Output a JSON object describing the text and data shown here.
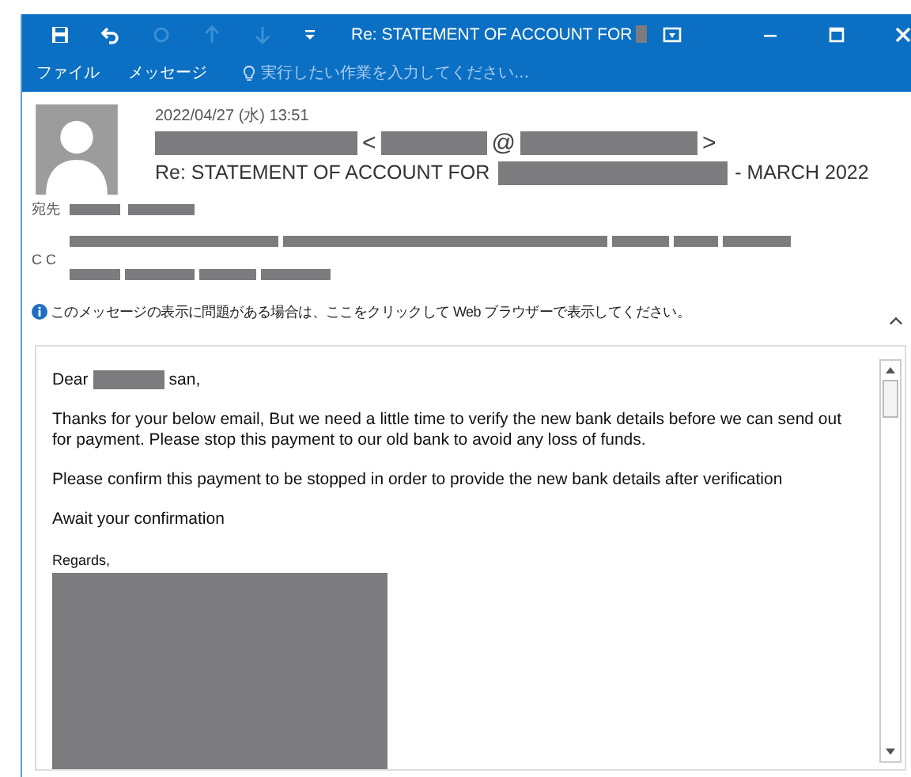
{
  "window": {
    "title": "Re: STATEMENT OF ACCOUNT FOR"
  },
  "ribbon": {
    "tabs": [
      {
        "label": "ファイル"
      },
      {
        "label": "メッセージ"
      }
    ],
    "search": {
      "placeholder": "実行したい作業を入力してください..."
    }
  },
  "header": {
    "date": "2022/04/27 (水) 13:51",
    "sender_open": "<",
    "sender_at": "@",
    "sender_close": ">",
    "subject_start": "Re: STATEMENT OF ACCOUNT FOR",
    "subject_end": "- MARCH 2022",
    "to_label": "宛先",
    "cc_label": "C C"
  },
  "info_bar": {
    "text": "このメッセージの表示に問題がある場合は、ここをクリックして Web ブラウザーで表示してください。"
  },
  "body": {
    "greeting_start": "Dear",
    "greeting_end": "san,",
    "paragraphs": [
      "Thanks for your below email, But we need a little time to verify the new bank details before we can send out for payment. Please stop this payment to our old bank to avoid any loss of funds.",
      "Please confirm this payment to be stopped in order to provide the new bank details after verification",
      "Await your confirmation"
    ],
    "signoff": "Regards,"
  }
}
